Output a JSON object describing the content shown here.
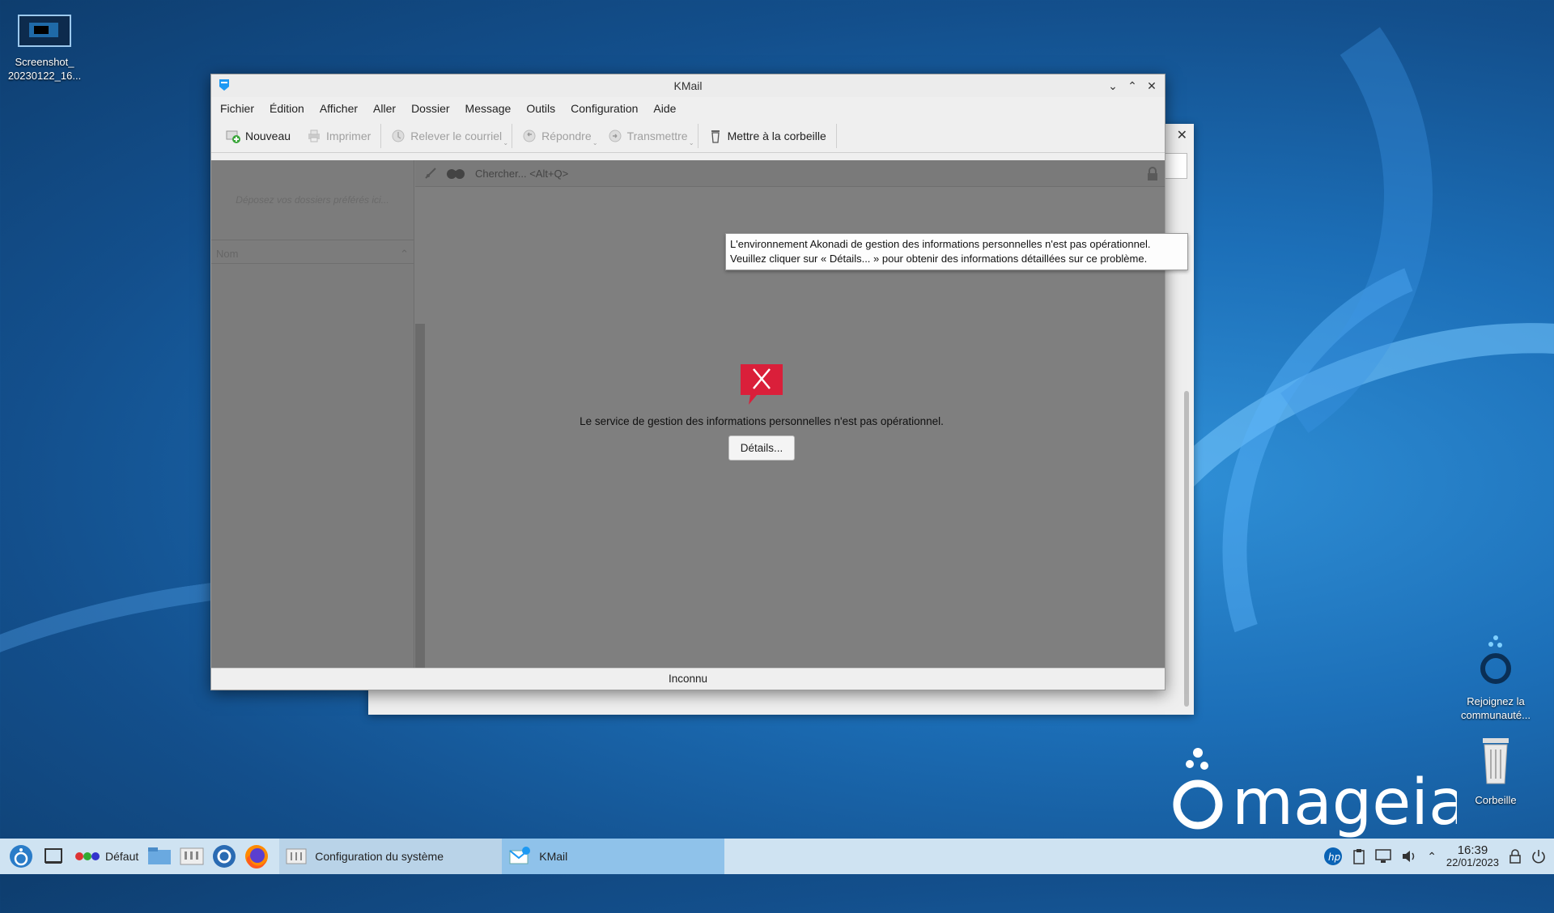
{
  "desktop": {
    "icons": [
      {
        "label_line1": "Screenshot_",
        "label_line2": "20230122_16..."
      },
      {
        "label_line1": "Rejoignez la",
        "label_line2": "communauté..."
      },
      {
        "label_line1": "Corbeille",
        "label_line2": ""
      }
    ],
    "brand": "mageia"
  },
  "kmail": {
    "title": "KMail",
    "menu": [
      "Fichier",
      "Édition",
      "Afficher",
      "Aller",
      "Dossier",
      "Message",
      "Outils",
      "Configuration",
      "Aide"
    ],
    "toolbar": {
      "new": "Nouveau",
      "print": "Imprimer",
      "check_mail": "Relever le courriel",
      "reply": "Répondre",
      "forward": "Transmettre",
      "trash": "Mettre à la corbeille"
    },
    "favorites_placeholder": "Déposez vos dossiers préférés ici...",
    "folder_column": "Nom",
    "search_placeholder": "Chercher... <Alt+Q>",
    "error_message": "Le service de gestion des informations personnelles n'est pas opérationnel.",
    "details_button": "Détails...",
    "status": "Inconnu",
    "tooltip_line1": "L'environnement Akonadi de gestion des informations personnelles n'est pas opérationnel.",
    "tooltip_line2": "Veuillez cliquer sur « Détails... » pour obtenir des informations détaillées sur ce problème."
  },
  "taskbar": {
    "activity": "Défaut",
    "tasks": [
      {
        "label": "Configuration du système",
        "state": "inactive"
      },
      {
        "label": "KMail",
        "state": "active"
      }
    ],
    "time": "16:39",
    "date": "22/01/2023"
  },
  "colors": {
    "accent": "#1d99f3",
    "error_red": "#da1f3a",
    "taskbar_bg": "#cfe3f2",
    "active_task": "#8fc2ea"
  }
}
